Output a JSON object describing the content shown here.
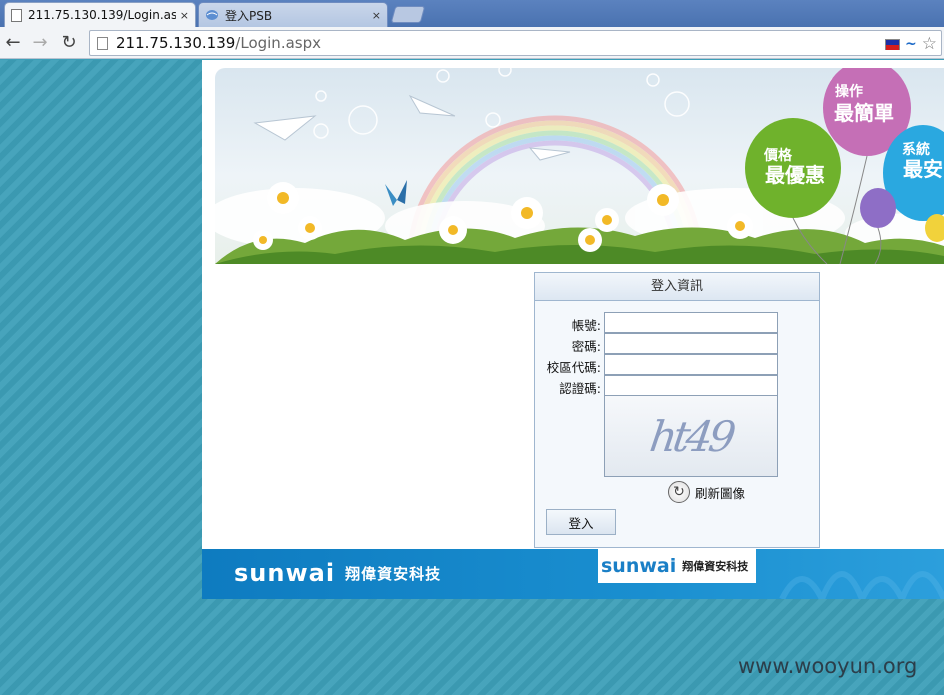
{
  "browser": {
    "tabs": [
      {
        "title": "211.75.130.139/Login.as",
        "close": "×"
      },
      {
        "title": "登入PSB",
        "close": "×"
      }
    ],
    "url_host": "211.75.130.139",
    "url_path": "/Login.aspx"
  },
  "banner": {
    "balloon1_top": "操作",
    "balloon1_bottom": "最簡單",
    "balloon2_top": "價格",
    "balloon2_bottom": "最優惠",
    "balloon3_top": "系統",
    "balloon3_bottom": "最安"
  },
  "login": {
    "header": "登入資訊",
    "fields": [
      {
        "label": "帳號:",
        "value": ""
      },
      {
        "label": "密碼:",
        "value": ""
      },
      {
        "label": "校區代碼:",
        "value": ""
      },
      {
        "label": "認證碼:",
        "value": ""
      }
    ],
    "captcha_text": "ht49",
    "refresh_label": "刷新圖像",
    "submit_label": "登入"
  },
  "footer": {
    "logo_word": "sunwai",
    "logo_cn": "翔偉資安科技",
    "badge_word": "sunwai",
    "badge_cn": "翔偉資安科技"
  },
  "watermark": "www.wooyun.org"
}
